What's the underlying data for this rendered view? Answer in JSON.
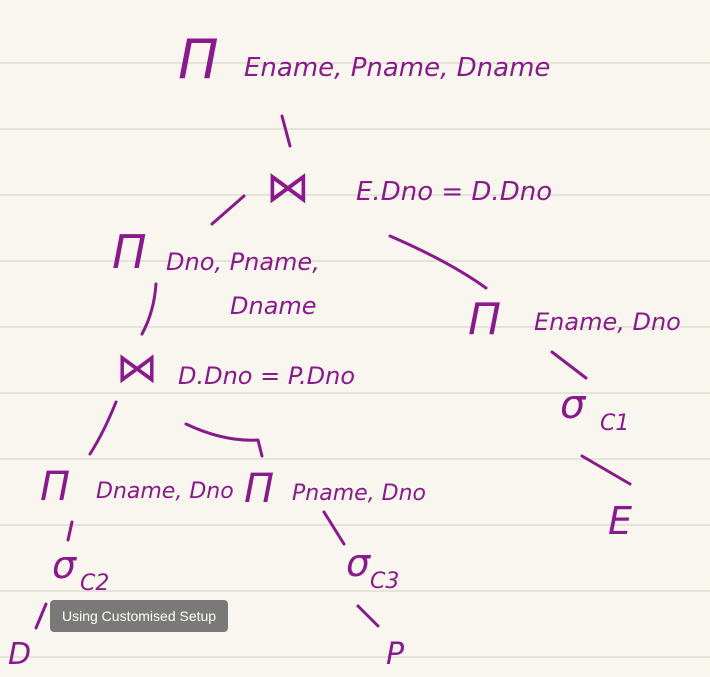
{
  "tree": {
    "root_symbol": "Π",
    "root_attrs": "Ename, Pname, Dname",
    "top_join_symbol": "⋈",
    "top_join_condition": "E.Dno = D.Dno",
    "left_project_symbol": "Π",
    "left_project_attrs_line1": "Dno, Pname,",
    "left_project_attrs_line2": "Dname",
    "mid_join_symbol": "⋈",
    "mid_join_condition": "D.Dno = P.Dno",
    "right_project_symbol": "Π",
    "right_project_attrs": "Ename, Dno",
    "select_c1_symbol": "σ",
    "select_c1_sub": "C1",
    "relation_e": "E",
    "ll_project_symbol": "Π",
    "ll_project_attrs": "Dname, Dno",
    "lr_project_symbol": "Π",
    "lr_project_attrs": "Pname, Dno",
    "select_c2_symbol": "σ",
    "select_c2_sub": "C2",
    "relation_d": "D",
    "select_c3_symbol": "σ",
    "select_c3_sub": "C3",
    "relation_p": "P"
  },
  "toast": {
    "label": "Using Customised Setup"
  },
  "colors": {
    "ink": "#8a1a8c",
    "paper": "#f8f6ee",
    "rule_line": "#e6e3d9",
    "toast_bg": "#6e6e6e"
  }
}
